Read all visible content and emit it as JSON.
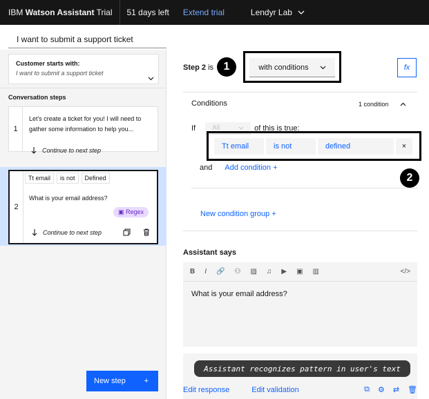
{
  "topbar": {
    "brand_prefix": "IBM",
    "brand_name": "Watson Assistant",
    "trial": "Trial",
    "days_left": "51 days left",
    "extend": "Extend trial",
    "workspace": "Lendyr Lab"
  },
  "action": {
    "title": "I want to submit a support ticket"
  },
  "customer_starts": {
    "title": "Customer starts with:",
    "text": "I want to submit a support ticket"
  },
  "conversation": {
    "heading": "Conversation steps",
    "steps": [
      {
        "number": "1",
        "text": "Let's create a ticket for you! I will need to gather some information to help you...",
        "continue": "Continue to next step"
      },
      {
        "number": "2",
        "chips": [
          "Tt email",
          "is not",
          "Defined"
        ],
        "text": "What is your email address?",
        "badge": "Regex",
        "continue": "Continue to next step"
      }
    ],
    "new_step": "New step"
  },
  "editor": {
    "step_label": "Step 2",
    "step_is": "is",
    "condition_mode": "with conditions",
    "fx": "fx",
    "callouts": [
      "1",
      "2"
    ],
    "conditions": {
      "heading": "Conditions",
      "count": "1 condition",
      "if": "If",
      "all": "All",
      "of_true": "of this is true:",
      "variable": "Tt email",
      "operator": "is not",
      "value": "defined",
      "remove": "×",
      "and": "and",
      "add_condition": "Add condition",
      "new_group": "New condition group"
    },
    "assistant_says": {
      "heading": "Assistant says",
      "toolbar": [
        "B",
        "I",
        "link",
        "variable",
        "image",
        "audio",
        "video",
        "iframe",
        "columns",
        "code"
      ],
      "text": "What is your email address?"
    },
    "tooltip": "Assistant recognizes pattern in user's text",
    "edit_response": "Edit response",
    "edit_validation": "Edit validation"
  }
}
